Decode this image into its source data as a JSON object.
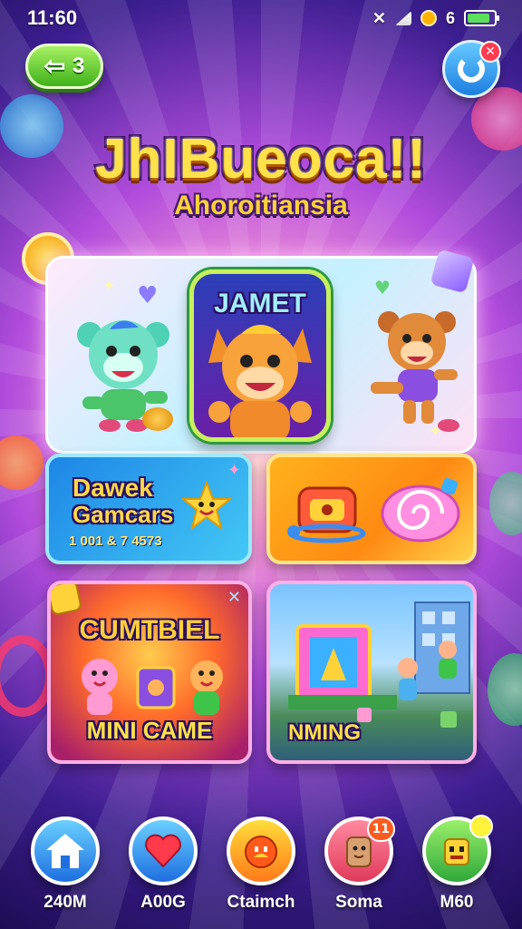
{
  "status_bar": {
    "time": "11:60",
    "battery_level": "6",
    "battery_fill": 0.85
  },
  "top_bar": {
    "back_count": "3"
  },
  "header": {
    "title": "JhIBueoca!!",
    "subtitle": "Ahoroitiansia"
  },
  "featured": {
    "title": "JAMET"
  },
  "cards": {
    "quests": {
      "title_line1": "Dawek",
      "title_line2": "Gamcars",
      "caption": "1 001 & 7 4573"
    },
    "mini": {
      "title": "CUMTBIEL",
      "caption": "MINI CAME"
    },
    "build": {
      "caption": "NMING"
    }
  },
  "bottom_nav": [
    {
      "label": "240M",
      "icon": "home-icon",
      "color": "#2f8cf0"
    },
    {
      "label": "A00G",
      "icon": "heart-icon",
      "color": "#2f8cf0"
    },
    {
      "label": "Ctaimch",
      "icon": "character-icon",
      "color": "#ff7a1a"
    },
    {
      "label": "Soma",
      "icon": "cookie-icon",
      "color": "#ff4e6a",
      "badge": "11"
    },
    {
      "label": "M60",
      "icon": "monster-icon",
      "color": "#3fc44a"
    }
  ]
}
